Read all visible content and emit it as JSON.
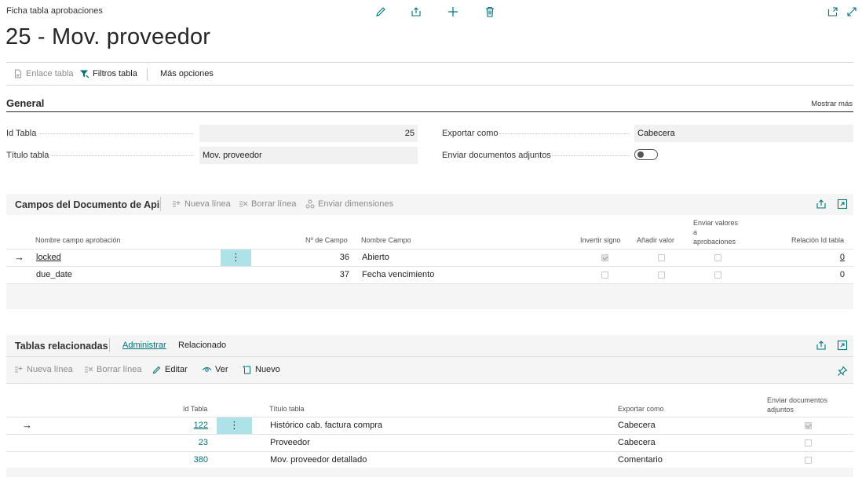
{
  "page": {
    "breadcrumb": "Ficha tabla aprobaciones",
    "title": "25 - Mov. proveedor"
  },
  "header_icons": [
    "pencil-icon",
    "share-icon",
    "plus-icon",
    "trash-icon",
    "pop-out-icon",
    "expand-icon"
  ],
  "actionbar": {
    "enlace_tabla": "Enlace tabla",
    "filtros_tabla": "Filtros tabla",
    "mas_opciones": "Más opciones"
  },
  "general": {
    "title": "General",
    "show_more": "Mostrar más",
    "id_tabla_label": "Id Tabla",
    "id_tabla_value": "25",
    "titulo_tabla_label": "Título tabla",
    "titulo_tabla_value": "Mov. proveedor",
    "exportar_como_label": "Exportar como",
    "exportar_como_value": "Cabecera",
    "enviar_adjuntos_label": "Enviar documentos adjuntos",
    "enviar_adjuntos_value": false
  },
  "campos": {
    "title": "Campos del Documento de Api",
    "actions": {
      "nueva_linea": "Nueva línea",
      "borrar_linea": "Borrar línea",
      "enviar_dimensiones": "Enviar dimensiones"
    },
    "columns": {
      "nombre_campo_aprobacion": "Nombre campo aprobación",
      "no_campo": "Nº de Campo",
      "nombre_campo": "Nombre Campo",
      "invertir_signo": "Invertir signo",
      "anadir_valor": "Añadir valor",
      "enviar_valores_1": "Enviar valores",
      "enviar_valores_2": "a",
      "enviar_valores_3": "aprobaciones",
      "relacion_id_tabla": "Relación Id tabla"
    },
    "rows": [
      {
        "nombre": "locked",
        "no": "36",
        "campo": "Abierto",
        "invertir": true,
        "anadir": false,
        "enviar": false,
        "relacion": "0"
      },
      {
        "nombre": "due_date",
        "no": "37",
        "campo": "Fecha vencimiento",
        "invertir": false,
        "anadir": false,
        "enviar": false,
        "relacion": "0"
      }
    ]
  },
  "relacionadas": {
    "title": "Tablas relacionadas",
    "tabs": {
      "administrar": "Administrar",
      "relacionado": "Relacionado"
    },
    "actions": {
      "nueva_linea": "Nueva línea",
      "borrar_linea": "Borrar línea",
      "editar": "Editar",
      "ver": "Ver",
      "nuevo": "Nuevo"
    },
    "columns": {
      "id_tabla": "Id Tabla",
      "titulo_tabla": "Título tabla",
      "exportar_como": "Exportar como",
      "enviar_docs_1": "Enviar documentos",
      "enviar_docs_2": "adjuntos"
    },
    "rows": [
      {
        "id": "122",
        "titulo": "Histórico cab. factura compra",
        "exportar": "Cabecera",
        "enviar": true
      },
      {
        "id": "23",
        "titulo": "Proveedor",
        "exportar": "Cabecera",
        "enviar": false
      },
      {
        "id": "380",
        "titulo": "Mov. proveedor detallado",
        "exportar": "Comentario",
        "enviar": false
      }
    ]
  },
  "colors": {
    "accent": "#00707a",
    "selected_cell": "#ade3e8",
    "panel_bg": "#f5f5f5"
  }
}
